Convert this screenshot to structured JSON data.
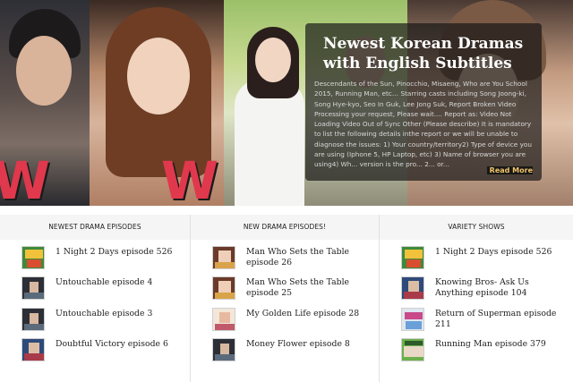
{
  "hero": {
    "title": "Newest Korean Dramas with English Subtitles",
    "description": "Descendants of the Sun, Pinocchio, Misaeng, Who are You School 2015, Running Man, etc… Starring casts including Song Joong-ki, Song Hye-kyo, Seo In Guk, Lee Jong Suk, Report Broken Video Processing your request, Please wait.... Report as: Video Not Loading Video Out of Sync Other (Please describe) It is mandatory to list the following details inthe report or we will be unable to diagnose the issues: 1) Your country/territory2) Type of device you are using (Iphone 5, HP Laptop, etc) 3) Name of browser you are using4) Wh... version is the pro... 2... or...",
    "read_more": "Read More",
    "logo_letter": "W"
  },
  "columns": [
    {
      "heading": "NEWEST DRAMA EPISODES",
      "items": [
        {
          "title": "1 Night 2 Days episode 526",
          "thumb": "variety"
        },
        {
          "title": "Untouchable episode 4",
          "thumb": "drama-dark"
        },
        {
          "title": "Untouchable episode 3",
          "thumb": "drama-dark"
        },
        {
          "title": "Doubtful Victory episode 6",
          "thumb": "drama-blue"
        }
      ]
    },
    {
      "heading": "NEW DRAMA EPISODES!",
      "items": [
        {
          "title": "Man Who Sets the Table episode 26",
          "thumb": "drama-warm"
        },
        {
          "title": "Man Who Sets the Table episode 25",
          "thumb": "drama-warm"
        },
        {
          "title": "My Golden Life episode 28",
          "thumb": "drama-light"
        },
        {
          "title": "Money Flower episode 8",
          "thumb": "drama-dark"
        }
      ]
    },
    {
      "heading": "VARIETY SHOWS",
      "items": [
        {
          "title": "1 Night 2 Days episode 526",
          "thumb": "variety"
        },
        {
          "title": "Knowing Bros- Ask Us Anything episode 104",
          "thumb": "drama-blue"
        },
        {
          "title": "Return of Superman episode 211",
          "thumb": "variety-light"
        },
        {
          "title": "Running Man episode 379",
          "thumb": "variety-green"
        }
      ]
    }
  ]
}
